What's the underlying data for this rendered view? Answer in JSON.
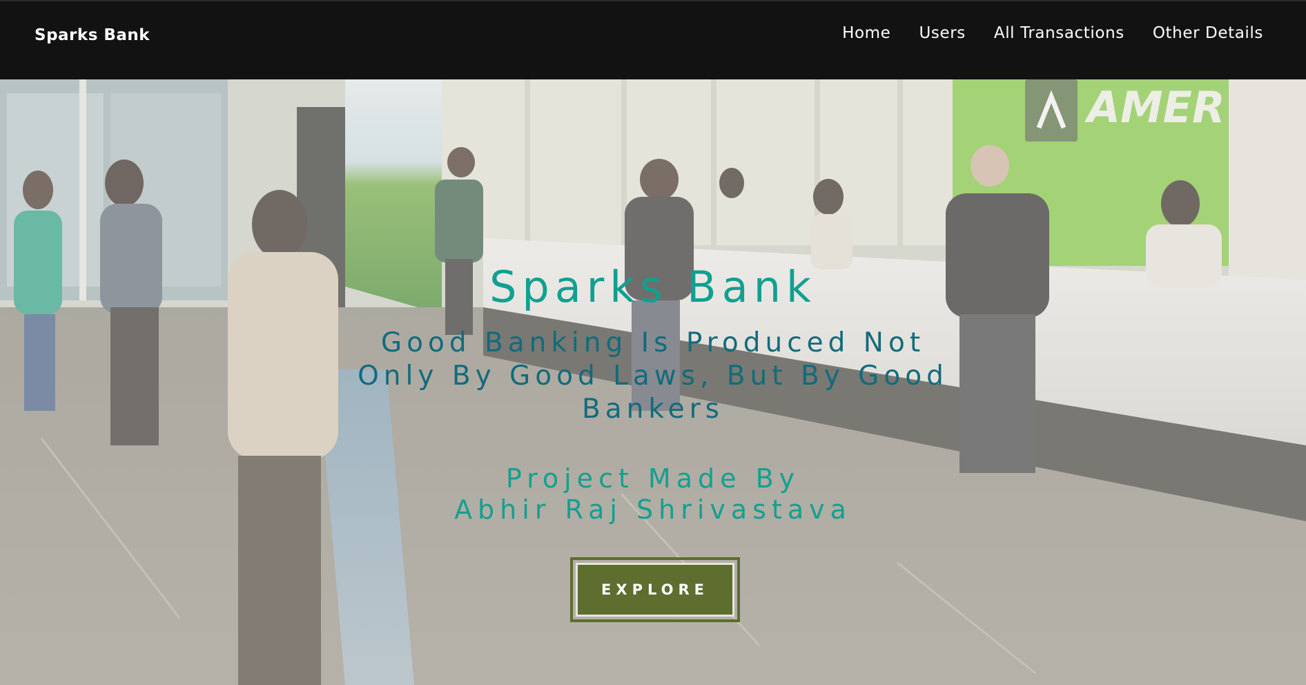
{
  "navbar": {
    "brand": "Sparks Bank",
    "links": [
      {
        "label": "Home"
      },
      {
        "label": "Users"
      },
      {
        "label": "All Transactions"
      },
      {
        "label": "Other Details"
      }
    ]
  },
  "hero": {
    "title": "Sparks Bank",
    "tagline": "Good Banking Is Produced Not Only By Good Laws, But By Good Bankers",
    "credit_label": "Project Made By",
    "credit_name": "Abhir Raj Shrivastava",
    "cta_label": "EXPLORE",
    "background_image": "bank-lobby-photo",
    "sign_text": "AMER"
  },
  "colors": {
    "navbar_bg": "#121212",
    "title_teal": "#0fa091",
    "tagline_blue": "#116b7c",
    "button_green": "#5d6e2f"
  }
}
